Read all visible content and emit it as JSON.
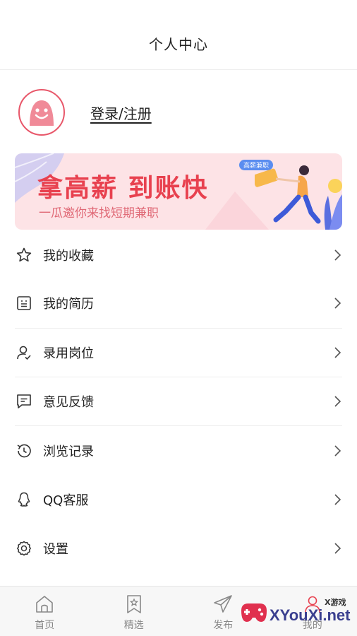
{
  "header": {
    "title": "个人中心"
  },
  "profile": {
    "login_label": "登录/注册"
  },
  "banner": {
    "headline": "拿高薪  到账快",
    "subline": "一瓜邀你来找短期兼职",
    "tag": "高薪兼职"
  },
  "menu": {
    "items": [
      {
        "label": "我的收藏",
        "icon": "star-icon"
      },
      {
        "label": "我的简历",
        "icon": "resume-icon"
      },
      {
        "label": "录用岗位",
        "icon": "user-check-icon"
      },
      {
        "label": "意见反馈",
        "icon": "feedback-icon"
      },
      {
        "label": "浏览记录",
        "icon": "history-icon"
      },
      {
        "label": "QQ客服",
        "icon": "qq-icon"
      },
      {
        "label": "设置",
        "icon": "gear-icon"
      }
    ]
  },
  "tabbar": {
    "tabs": [
      {
        "label": "首页",
        "icon": "home-icon"
      },
      {
        "label": "精选",
        "icon": "bookmark-star-icon"
      },
      {
        "label": "发布",
        "icon": "paper-plane-icon"
      },
      {
        "label": "我的",
        "icon": "user-icon"
      }
    ]
  },
  "watermark": {
    "brand": "XYouXi.net",
    "small": "X游戏"
  },
  "colors": {
    "accent": "#e8414f",
    "avatar_border": "#e8576a",
    "banner_bg": "#fde3e6"
  }
}
